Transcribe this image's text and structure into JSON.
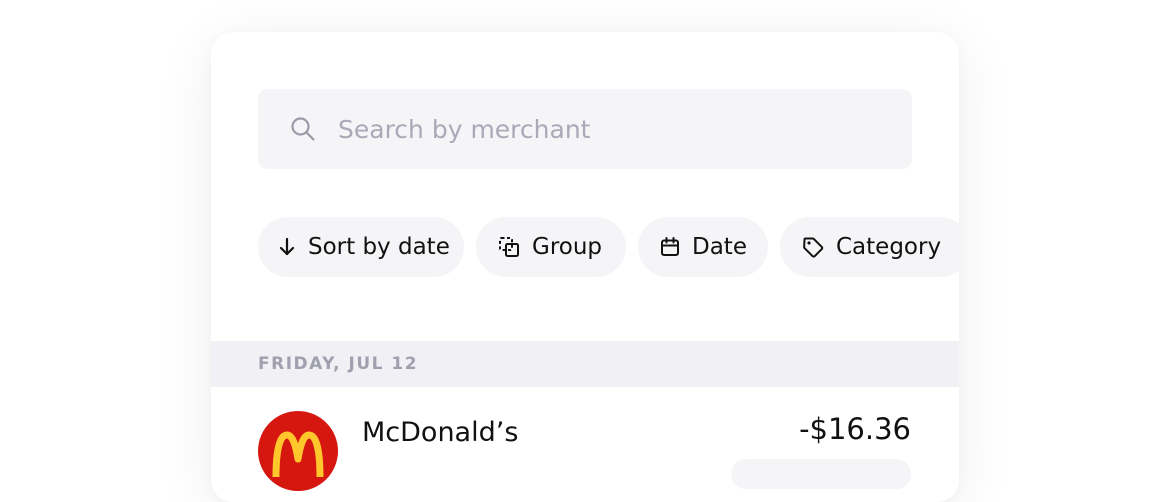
{
  "search": {
    "placeholder": "Search by merchant",
    "icon": "search-icon"
  },
  "filters": [
    {
      "label": "Sort by date",
      "icon": "arrow-down-icon"
    },
    {
      "label": "Group",
      "icon": "group-icon"
    },
    {
      "label": "Date",
      "icon": "calendar-icon"
    },
    {
      "label": "Category",
      "icon": "tag-icon"
    }
  ],
  "transactions": {
    "date_header": "FRIDAY, JUL 12",
    "items": [
      {
        "merchant": "McDonald’s",
        "amount": "-$16.36",
        "logo_color": "#d6170f",
        "logo_mark_color": "#ffc72c"
      }
    ]
  },
  "colors": {
    "surface": "#f5f5f8",
    "header_bg": "#f1f1f5",
    "muted_text": "#a0a0ae",
    "placeholder": "#a9a9b8"
  }
}
